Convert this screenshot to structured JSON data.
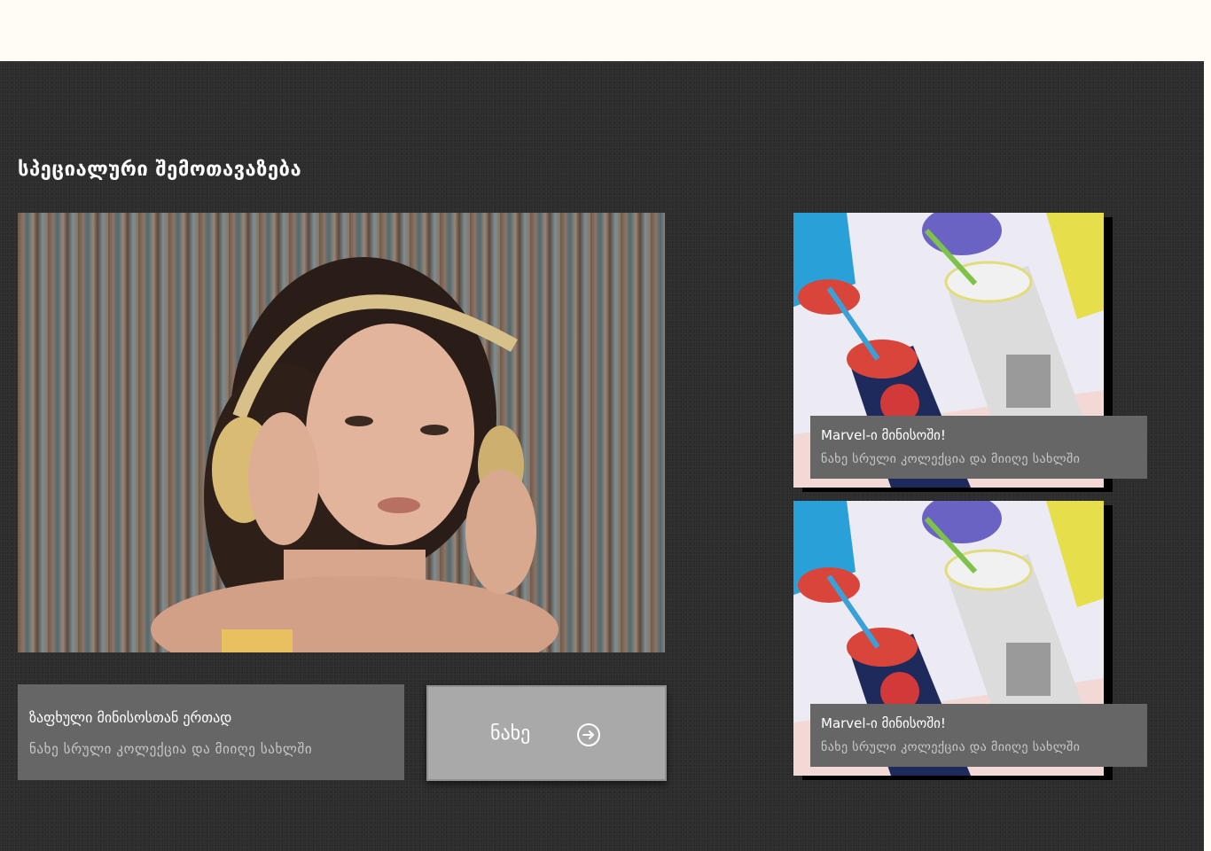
{
  "section": {
    "title": "სპეციალური შემოთავაზება"
  },
  "hero": {
    "title": "ზაფხული მინისოსთან ერთად",
    "subtitle": "ნახე სრული კოლექცია და მიიღე სახლში",
    "button_label": "ნახე",
    "button_icon": "arrow-right-circle-icon"
  },
  "cards": [
    {
      "title": "Marvel-ი მინისოში!",
      "subtitle": "ნახე სრული კოლექცია და მიიღე სახლში"
    },
    {
      "title": "Marvel-ი მინისოში!",
      "subtitle": "ნახე სრული კოლექცია და მიიღე სახლში"
    }
  ],
  "colors": {
    "section_bg": "#2d2d2d",
    "panel_bg": "#666666",
    "button_bg": "#a9a9a9",
    "top_bg": "#fffcf6"
  }
}
